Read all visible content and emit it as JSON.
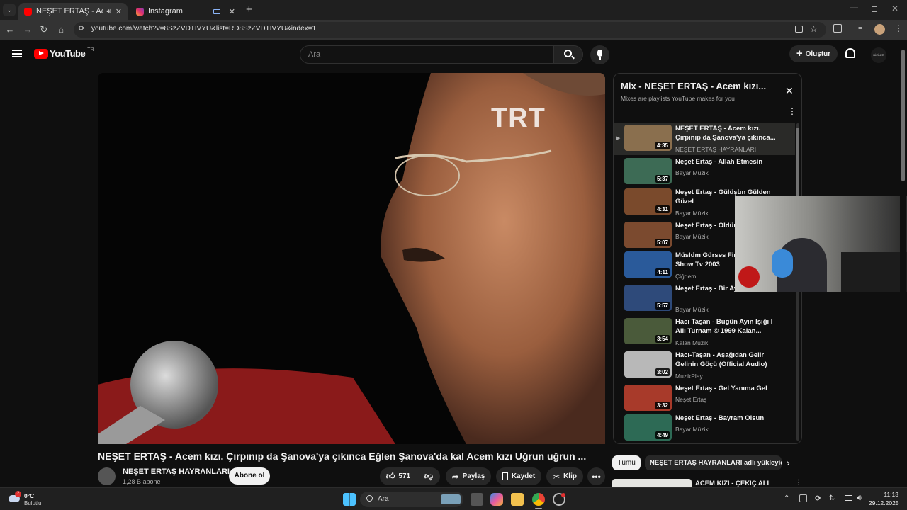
{
  "browser": {
    "tabs": [
      {
        "title": "NEŞET ERTAŞ - Acem kızı. Ç",
        "active": true,
        "favicon": "youtube-favicon"
      },
      {
        "title": "Instagram",
        "active": false,
        "favicon": "instagram-favicon"
      }
    ],
    "url": "youtube.com/watch?v=8SzZVDTIVYU&list=RD8SzZVDTIVYU&index=1"
  },
  "youtube": {
    "logo_text": "YouTube",
    "region_badge": "TR",
    "search_placeholder": "Ara",
    "create_label": "Oluştur",
    "avatar_text": "DİZİLER"
  },
  "video": {
    "watermark": "TRT",
    "title": "NEŞET ERTAŞ - Acem kızı. Çırpınıp da Şanova'ya çıkınca Eğlen Şanova'da kal Acem kızı Uğrun uğrun ...",
    "channel_name": "NEŞET ERTAŞ HAYRANLARI",
    "subscribers": "1,28 B abone",
    "subscribe_label": "Abone ol",
    "likes": "571",
    "share_label": "Paylaş",
    "save_label": "Kaydet",
    "clip_label": "Klip"
  },
  "playlist": {
    "title": "Mix - NEŞET ERTAŞ - Acem kızı...",
    "subtitle": "Mixes are playlists YouTube makes for you",
    "items": [
      {
        "title": "NEŞET ERTAŞ - Acem kızı. Çırpınıp da Şanova'ya çıkınca...",
        "channel": "NEŞET ERTAŞ HAYRANLARI",
        "duration": "4:35",
        "playing": true,
        "thumb_color": "#8a6f4e"
      },
      {
        "title": "Neşet Ertaş - Allah Etmesin",
        "channel": "Bayar Müzik",
        "duration": "5:37",
        "playing": false,
        "thumb_color": "#3d6b55"
      },
      {
        "title": "Neşet Ertaş - Gülüşün Gülden Güzel",
        "channel": "Bayar Müzik",
        "duration": "4:31",
        "playing": false,
        "thumb_color": "#7a4a2c"
      },
      {
        "title": "Neşet Ertaş - Öldürm",
        "channel": "Bayar Müzik",
        "duration": "5:07",
        "playing": false,
        "thumb_color": "#7b4a2f"
      },
      {
        "title": "Müslüm Gürses Finc Düet Show Tv 2003",
        "channel": "Çiğdem",
        "duration": "4:11",
        "playing": false,
        "thumb_color": "#2a5a9a"
      },
      {
        "title": "Neşet Ertaş - Bir Ayr Yoksulluk",
        "channel": "Bayar Müzik",
        "duration": "5:57",
        "playing": false,
        "thumb_color": "#2e4a7a"
      },
      {
        "title": "Hacı Taşan - Bugün Ayın Işığı I Allı Turnam © 1999 Kalan...",
        "channel": "Kalan Müzik",
        "duration": "3:54",
        "playing": false,
        "thumb_color": "#4a5a3a"
      },
      {
        "title": "Hacı-Taşan - Aşağıdan Gelir Gelinin Göçü (Official Audio)",
        "channel": "MuzikPlay",
        "duration": "3:02",
        "playing": false,
        "thumb_color": "#b8b8b8"
      },
      {
        "title": "Neşet Ertaş - Gel Yanıma Gel",
        "channel": "Neşet Ertaş",
        "duration": "3:32",
        "playing": false,
        "thumb_color": "#a83a2a"
      },
      {
        "title": "Neşet Ertaş - Bayram Olsun",
        "channel": "Bayar Müzik",
        "duration": "4:49",
        "playing": false,
        "thumb_color": "#2d6a55"
      }
    ]
  },
  "chips": {
    "all_label": "Tümü",
    "uploader_label": "NEŞET ERTAŞ HAYRANLARI adlı yükleyicid"
  },
  "next_video": {
    "title": "ACEM KIZI - ÇEKİÇ ALİ"
  },
  "taskbar": {
    "weather_temp": "0°C",
    "weather_desc": "Bulutlu",
    "weather_badge": "2",
    "search_placeholder": "Ara",
    "time": "11:13",
    "date": "29.12.2025"
  },
  "colors": {
    "youtube_red": "#ff0000",
    "background": "#0f0f0f",
    "chip_active": "#f1f1f1"
  }
}
